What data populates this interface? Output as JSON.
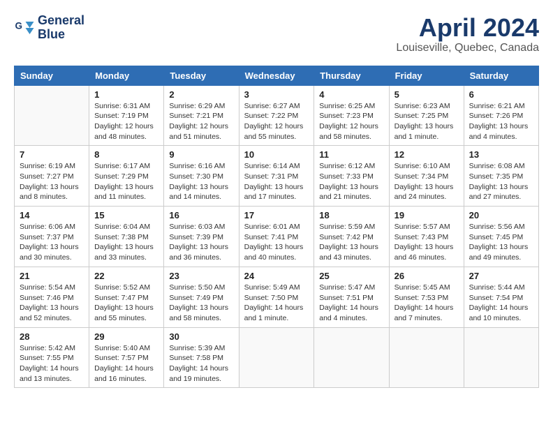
{
  "header": {
    "logo_line1": "General",
    "logo_line2": "Blue",
    "title": "April 2024",
    "subtitle": "Louiseville, Quebec, Canada"
  },
  "weekdays": [
    "Sunday",
    "Monday",
    "Tuesday",
    "Wednesday",
    "Thursday",
    "Friday",
    "Saturday"
  ],
  "weeks": [
    [
      {
        "day": "",
        "info": ""
      },
      {
        "day": "1",
        "info": "Sunrise: 6:31 AM\nSunset: 7:19 PM\nDaylight: 12 hours\nand 48 minutes."
      },
      {
        "day": "2",
        "info": "Sunrise: 6:29 AM\nSunset: 7:21 PM\nDaylight: 12 hours\nand 51 minutes."
      },
      {
        "day": "3",
        "info": "Sunrise: 6:27 AM\nSunset: 7:22 PM\nDaylight: 12 hours\nand 55 minutes."
      },
      {
        "day": "4",
        "info": "Sunrise: 6:25 AM\nSunset: 7:23 PM\nDaylight: 12 hours\nand 58 minutes."
      },
      {
        "day": "5",
        "info": "Sunrise: 6:23 AM\nSunset: 7:25 PM\nDaylight: 13 hours\nand 1 minute."
      },
      {
        "day": "6",
        "info": "Sunrise: 6:21 AM\nSunset: 7:26 PM\nDaylight: 13 hours\nand 4 minutes."
      }
    ],
    [
      {
        "day": "7",
        "info": "Sunrise: 6:19 AM\nSunset: 7:27 PM\nDaylight: 13 hours\nand 8 minutes."
      },
      {
        "day": "8",
        "info": "Sunrise: 6:17 AM\nSunset: 7:29 PM\nDaylight: 13 hours\nand 11 minutes."
      },
      {
        "day": "9",
        "info": "Sunrise: 6:16 AM\nSunset: 7:30 PM\nDaylight: 13 hours\nand 14 minutes."
      },
      {
        "day": "10",
        "info": "Sunrise: 6:14 AM\nSunset: 7:31 PM\nDaylight: 13 hours\nand 17 minutes."
      },
      {
        "day": "11",
        "info": "Sunrise: 6:12 AM\nSunset: 7:33 PM\nDaylight: 13 hours\nand 21 minutes."
      },
      {
        "day": "12",
        "info": "Sunrise: 6:10 AM\nSunset: 7:34 PM\nDaylight: 13 hours\nand 24 minutes."
      },
      {
        "day": "13",
        "info": "Sunrise: 6:08 AM\nSunset: 7:35 PM\nDaylight: 13 hours\nand 27 minutes."
      }
    ],
    [
      {
        "day": "14",
        "info": "Sunrise: 6:06 AM\nSunset: 7:37 PM\nDaylight: 13 hours\nand 30 minutes."
      },
      {
        "day": "15",
        "info": "Sunrise: 6:04 AM\nSunset: 7:38 PM\nDaylight: 13 hours\nand 33 minutes."
      },
      {
        "day": "16",
        "info": "Sunrise: 6:03 AM\nSunset: 7:39 PM\nDaylight: 13 hours\nand 36 minutes."
      },
      {
        "day": "17",
        "info": "Sunrise: 6:01 AM\nSunset: 7:41 PM\nDaylight: 13 hours\nand 40 minutes."
      },
      {
        "day": "18",
        "info": "Sunrise: 5:59 AM\nSunset: 7:42 PM\nDaylight: 13 hours\nand 43 minutes."
      },
      {
        "day": "19",
        "info": "Sunrise: 5:57 AM\nSunset: 7:43 PM\nDaylight: 13 hours\nand 46 minutes."
      },
      {
        "day": "20",
        "info": "Sunrise: 5:56 AM\nSunset: 7:45 PM\nDaylight: 13 hours\nand 49 minutes."
      }
    ],
    [
      {
        "day": "21",
        "info": "Sunrise: 5:54 AM\nSunset: 7:46 PM\nDaylight: 13 hours\nand 52 minutes."
      },
      {
        "day": "22",
        "info": "Sunrise: 5:52 AM\nSunset: 7:47 PM\nDaylight: 13 hours\nand 55 minutes."
      },
      {
        "day": "23",
        "info": "Sunrise: 5:50 AM\nSunset: 7:49 PM\nDaylight: 13 hours\nand 58 minutes."
      },
      {
        "day": "24",
        "info": "Sunrise: 5:49 AM\nSunset: 7:50 PM\nDaylight: 14 hours\nand 1 minute."
      },
      {
        "day": "25",
        "info": "Sunrise: 5:47 AM\nSunset: 7:51 PM\nDaylight: 14 hours\nand 4 minutes."
      },
      {
        "day": "26",
        "info": "Sunrise: 5:45 AM\nSunset: 7:53 PM\nDaylight: 14 hours\nand 7 minutes."
      },
      {
        "day": "27",
        "info": "Sunrise: 5:44 AM\nSunset: 7:54 PM\nDaylight: 14 hours\nand 10 minutes."
      }
    ],
    [
      {
        "day": "28",
        "info": "Sunrise: 5:42 AM\nSunset: 7:55 PM\nDaylight: 14 hours\nand 13 minutes."
      },
      {
        "day": "29",
        "info": "Sunrise: 5:40 AM\nSunset: 7:57 PM\nDaylight: 14 hours\nand 16 minutes."
      },
      {
        "day": "30",
        "info": "Sunrise: 5:39 AM\nSunset: 7:58 PM\nDaylight: 14 hours\nand 19 minutes."
      },
      {
        "day": "",
        "info": ""
      },
      {
        "day": "",
        "info": ""
      },
      {
        "day": "",
        "info": ""
      },
      {
        "day": "",
        "info": ""
      }
    ]
  ]
}
